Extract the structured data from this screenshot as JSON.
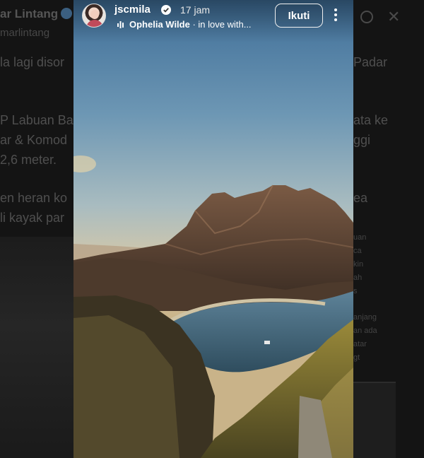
{
  "background_tweet": {
    "author_name": "ar Lintang",
    "author_handle": "marlintang",
    "left_lines": [
      "la lagi disor",
      "P Labuan Ba",
      "ar & Komod",
      "2,6 meter.",
      "en heran ko",
      "li kayak par"
    ],
    "right_lines": [
      "Padar",
      "ata ke",
      "ggi",
      "ea"
    ],
    "right_fragments": [
      "uan",
      "ca",
      "kin",
      "ah",
      "s",
      "anjang",
      "an ada",
      "atar",
      "gt"
    ]
  },
  "story": {
    "username": "jscmila",
    "posted_time": "17 jam",
    "music_artist": "Ophelia Wilde",
    "music_title": " · in love with...",
    "follow_label": "Ikuti",
    "icons": [
      "verified-icon",
      "music-bars-icon",
      "more-options-icon"
    ],
    "colors": {
      "follow_border": "#f0f0f0",
      "verified": "#ffffff",
      "sky_top": "#3f6e98",
      "sky_bottom": "#d7c9a8"
    }
  }
}
